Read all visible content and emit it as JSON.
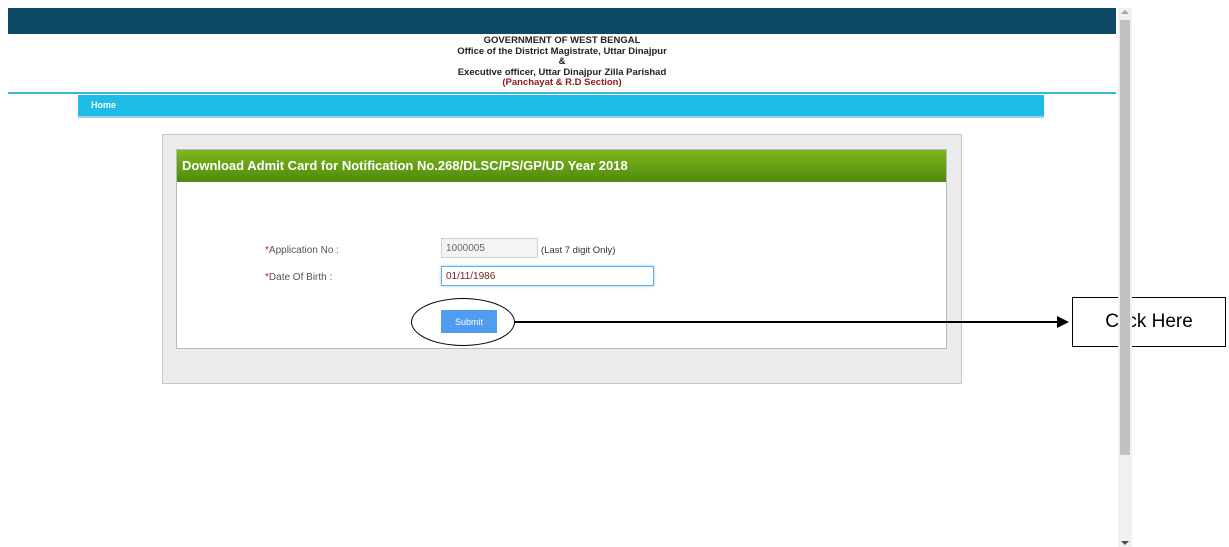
{
  "header": {
    "line1": "GOVERNMENT OF WEST BENGAL",
    "line2": "Office of the District Magistrate,   Uttar   Dinajpur",
    "line3": "&",
    "line4": "Executive officer,   Uttar   Dinajpur Zilla Parishad",
    "line5": "(Panchayat & R.D Section)"
  },
  "nav": {
    "home_label": "Home"
  },
  "form": {
    "title": "Download Admit Card for Notification No.268/DLSC/PS/GP/UD Year 2018",
    "required_mark": "*",
    "application_label": "Application No :",
    "application_value": "1000005",
    "application_hint": "(Last 7 digit Only)",
    "dob_label": "Date Of Birth :",
    "dob_value": "01/11/1986",
    "submit_label": "Submit"
  },
  "annotation": {
    "callout_text": "Click Here"
  },
  "colors": {
    "topbar": "#0d4a66",
    "navbar": "#1fbce8",
    "title_bar": "#5e9a14",
    "submit_button": "#4f9cf0",
    "required_mark": "#d41a1a"
  }
}
